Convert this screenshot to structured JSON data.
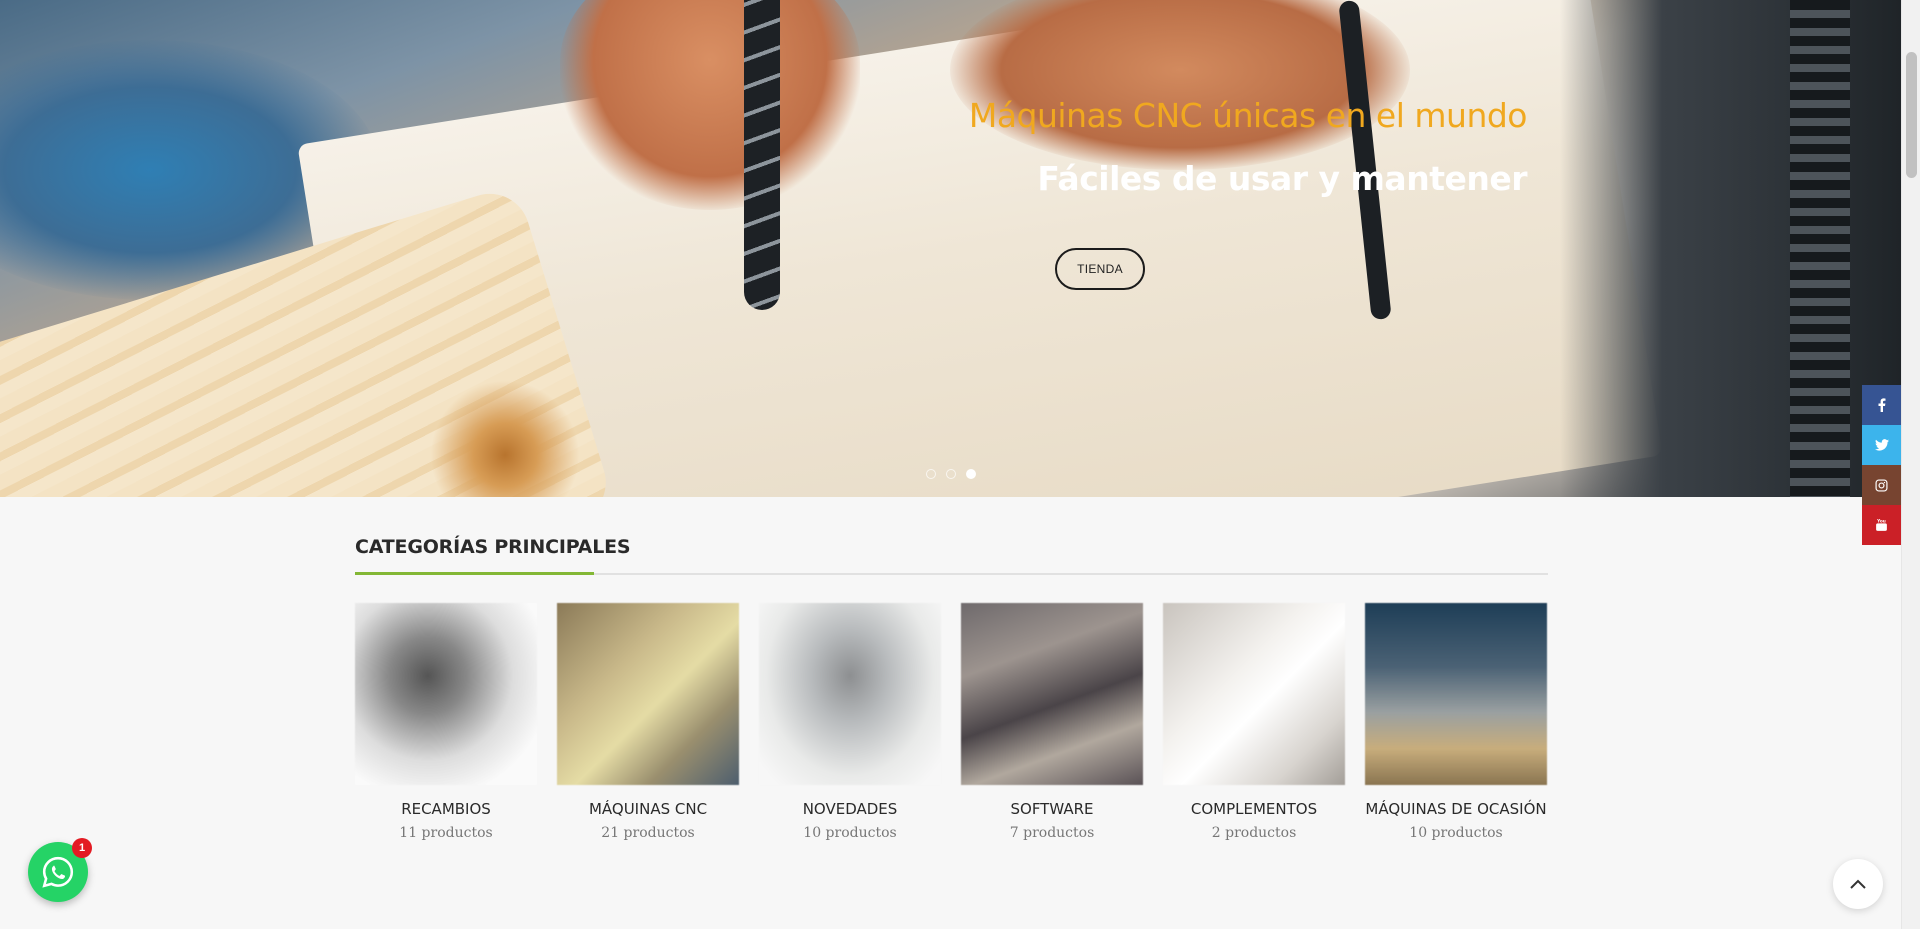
{
  "hero": {
    "title": "Máquinas CNC únicas en el mundo",
    "subtitle": "Fáciles de usar y mantener",
    "button_label": "TIENDA",
    "slides": 3,
    "active_slide": 3
  },
  "social": {
    "facebook_icon": "f",
    "twitter_icon": "t",
    "instagram_icon": "instagram",
    "youtube_icon": "youtube"
  },
  "categories": {
    "title": "CATEGORÍAS PRINCIPALES",
    "items": [
      {
        "name": "RECAMBIOS",
        "count": "11 productos"
      },
      {
        "name": "MÁQUINAS CNC",
        "count": "21 productos"
      },
      {
        "name": "NOVEDADES",
        "count": "10 productos"
      },
      {
        "name": "SOFTWARE",
        "count": "7 productos"
      },
      {
        "name": "COMPLEMENTOS",
        "count": "2 productos"
      },
      {
        "name": "MÁQUINAS DE OCASIÓN",
        "count": "10 productos"
      }
    ]
  },
  "whatsapp": {
    "badge_count": "1"
  },
  "colors": {
    "accent_green": "#83b735",
    "hero_orange": "#f0a81f",
    "whatsapp_green": "#25d366"
  }
}
